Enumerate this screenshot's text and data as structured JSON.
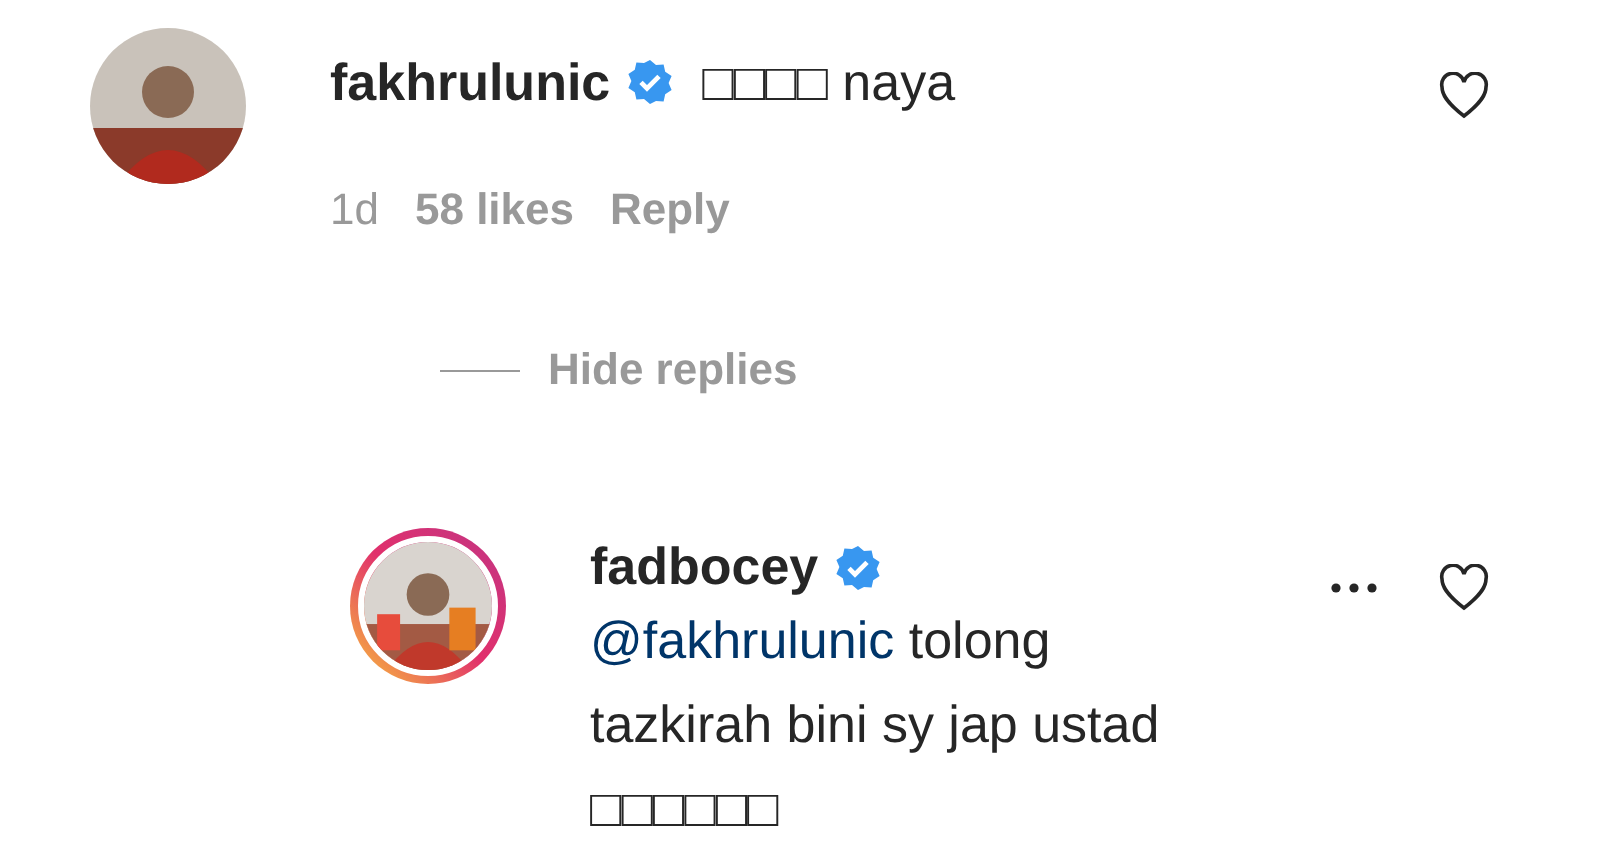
{
  "comments": [
    {
      "username": "fakhrulunic",
      "verified": true,
      "text": "□□□□ naya",
      "time": "1d",
      "likes": "58 likes",
      "reply_label": "Reply",
      "liked": false,
      "story_ring": false
    }
  ],
  "replies_toggle": "Hide replies",
  "replies": [
    {
      "username": "fadbocey",
      "verified": true,
      "mention": "@fakhrulunic",
      "text": "tolong tazkirah bini sy jap ustad □□□□□□",
      "liked": false,
      "story_ring": true
    }
  ]
}
